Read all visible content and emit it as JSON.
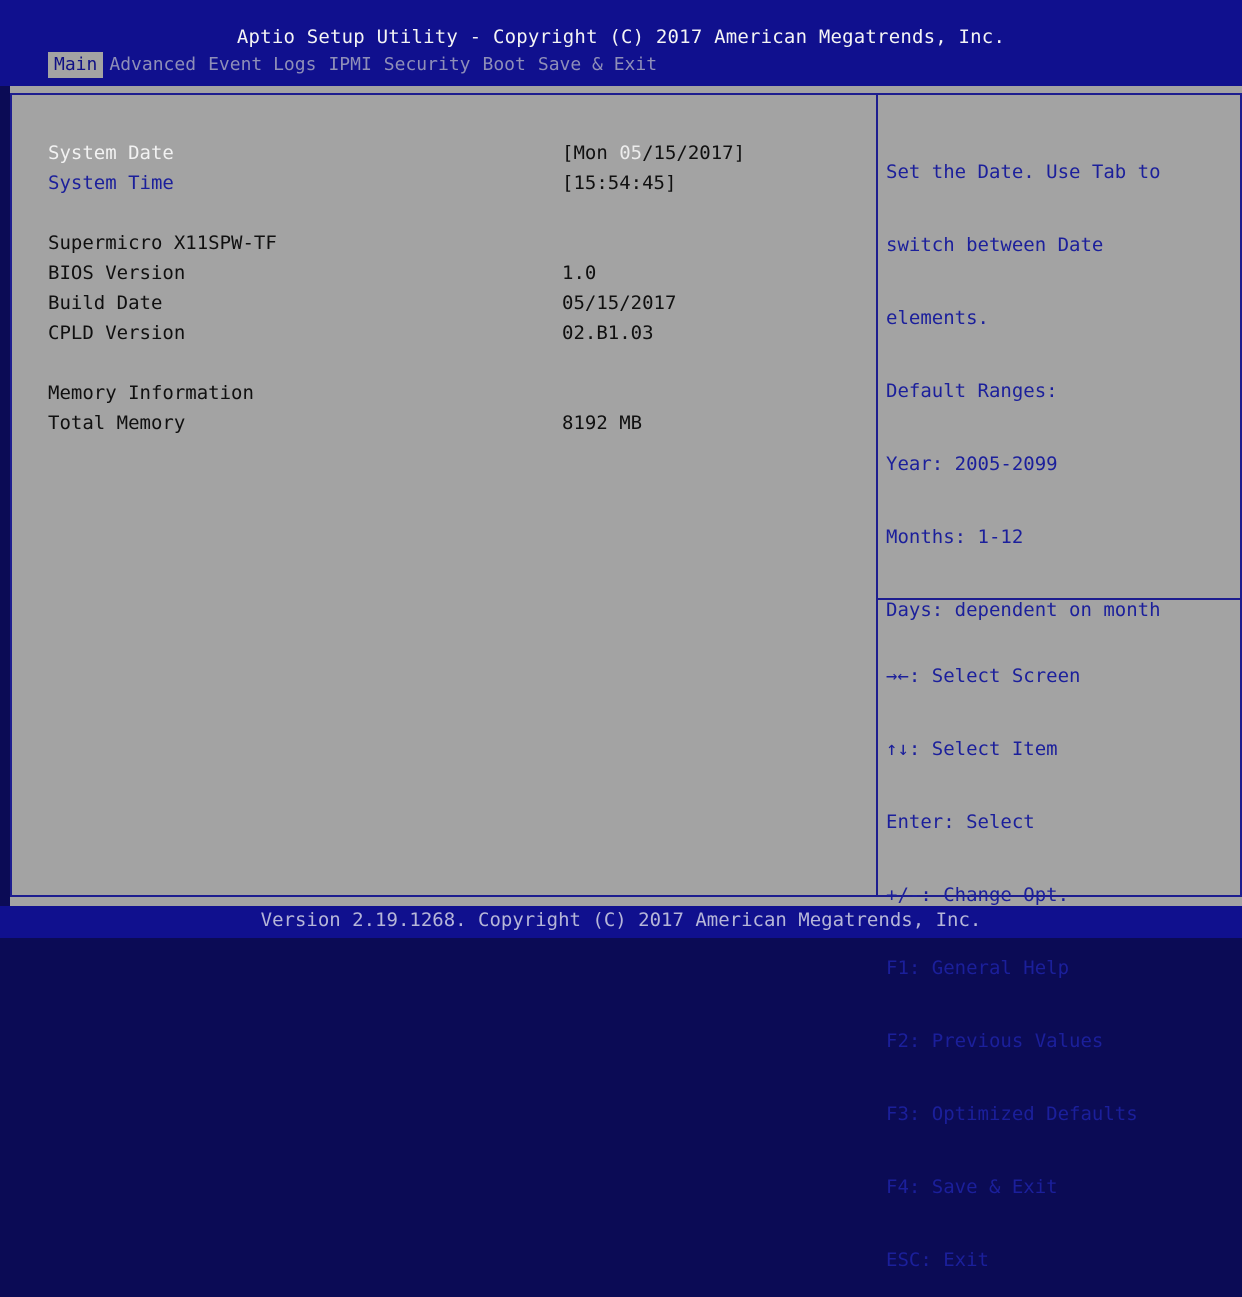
{
  "window": {
    "title": "Aptio Setup Utility - Copyright (C) 2017 American Megatrends, Inc."
  },
  "tabs": [
    {
      "label": "Main",
      "active": true
    },
    {
      "label": "Advanced",
      "active": false
    },
    {
      "label": "Event Logs",
      "active": false
    },
    {
      "label": "IPMI",
      "active": false
    },
    {
      "label": "Security",
      "active": false
    },
    {
      "label": "Boot",
      "active": false
    },
    {
      "label": "Save & Exit",
      "active": false
    }
  ],
  "main": {
    "system_date": {
      "label": "System Date",
      "value_prefix": "[Mon ",
      "value_highlight": "05",
      "value_suffix": "/15/2017]"
    },
    "system_time": {
      "label": "System Time",
      "value": "[15:54:45]"
    },
    "board_name": "Supermicro X11SPW-TF",
    "bios_version": {
      "label": "BIOS Version",
      "value": "1.0"
    },
    "build_date": {
      "label": "Build Date",
      "value": "05/15/2017"
    },
    "cpld_version": {
      "label": "CPLD Version",
      "value": "02.B1.03"
    },
    "memory_header": "Memory Information",
    "total_memory": {
      "label": "Total Memory",
      "value": "8192 MB"
    }
  },
  "help": {
    "lines": [
      "Set the Date. Use Tab to",
      "switch between Date",
      "elements.",
      "Default Ranges:",
      "Year: 2005-2099",
      "Months: 1-12",
      "Days: dependent on month"
    ]
  },
  "keys": {
    "lines": [
      "→←: Select Screen",
      "↑↓: Select Item",
      "Enter: Select",
      "+/-: Change Opt.",
      "F1: General Help",
      "F2: Previous Values",
      "F3: Optimized Defaults",
      "F4: Save & Exit",
      "ESC: Exit"
    ]
  },
  "footer": {
    "text": "Version 2.19.1268. Copyright (C) 2017 American Megatrends, Inc."
  }
}
